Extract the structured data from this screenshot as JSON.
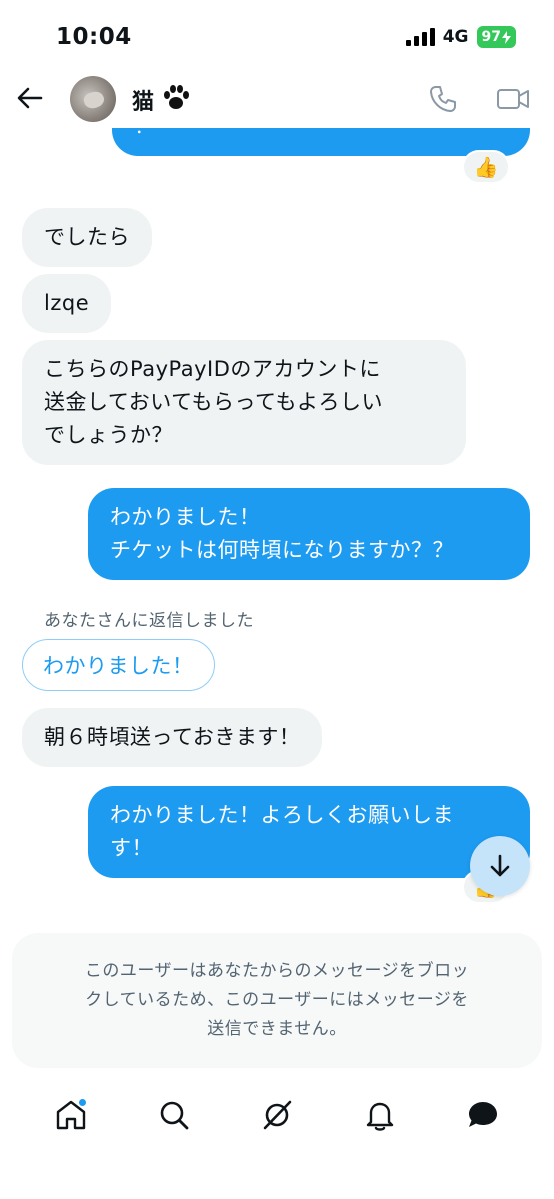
{
  "status_bar": {
    "time": "10:04",
    "network": "4G",
    "battery": "97"
  },
  "header": {
    "contact_name": "猫",
    "icons": [
      "back-arrow-icon",
      "paw-emoji-icon",
      "phone-icon",
      "video-camera-icon"
    ]
  },
  "messages": {
    "top_partial": "！",
    "top_reaction": "👍",
    "m1": "でしたら",
    "m2": "lzqe",
    "m3_line1": "こちらのPayPayIDのアカウントに",
    "m3_line2": "送金しておいてもらってもよろしい",
    "m3_line3": "でしょうか？",
    "m4_line1": "わかりました！",
    "m4_line2": "チケットは何時頃になりますか？？",
    "reply_label": "あなたさんに返信しました",
    "quoted_text": "わかりました！",
    "m5": "朝６時頃送っておきます！",
    "m6_line1": "わかりました！よろしくお願いしま",
    "m6_line2": "す！",
    "bottom_reaction": "👍"
  },
  "blocked_notice": {
    "line1": "このユーザーはあなたからのメッセージをブロッ",
    "line2": "クしているため、このユーザーにはメッセージを",
    "line3": "送信できません。"
  },
  "bottom_nav": {
    "items": [
      "home-icon",
      "search-icon",
      "grok-icon",
      "notifications-icon",
      "messages-icon"
    ],
    "accent": "#1d9bf0"
  },
  "colors": {
    "outgoing_bubble": "#1d9bf0",
    "incoming_bubble": "#eff3f4",
    "secondary_text": "#536471"
  }
}
